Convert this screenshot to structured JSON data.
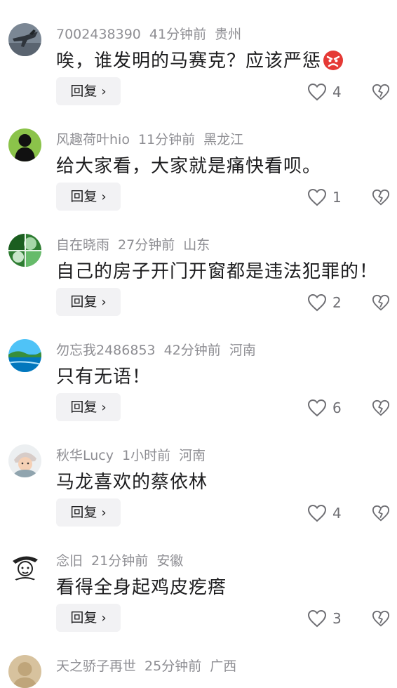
{
  "comments": [
    {
      "username": "7002438390",
      "time": "41分钟前",
      "location": "贵州",
      "text": "唉，谁发明的马赛克？应该严惩",
      "has_emoji": true,
      "reply_label": "回复",
      "likes": "4",
      "avatar": "jet"
    },
    {
      "username": "风趣荷叶hio",
      "time": "11分钟前",
      "location": "黑龙江",
      "text": "给大家看，大家就是痛快看呗。",
      "has_emoji": false,
      "reply_label": "回复",
      "likes": "1",
      "avatar": "silhouette"
    },
    {
      "username": "自在晓雨",
      "time": "27分钟前",
      "location": "山东",
      "text": "自己的房子开门开窗都是违法犯罪的！",
      "has_emoji": false,
      "reply_label": "回复",
      "likes": "2",
      "avatar": "green"
    },
    {
      "username": "勿忘我2486853",
      "time": "42分钟前",
      "location": "河南",
      "text": "只有无语！",
      "has_emoji": false,
      "reply_label": "回复",
      "likes": "6",
      "avatar": "lake"
    },
    {
      "username": "秋华Lucy",
      "time": "1小时前",
      "location": "河南",
      "text": "马龙喜欢的蔡依林",
      "has_emoji": false,
      "reply_label": "回复",
      "likes": "4",
      "avatar": "person"
    },
    {
      "username": "念旧",
      "time": "21分钟前",
      "location": "安徽",
      "text": "看得全身起鸡皮疙瘩",
      "has_emoji": false,
      "reply_label": "回复",
      "likes": "3",
      "avatar": "sketch"
    },
    {
      "username": "天之骄子再世",
      "time": "25分钟前",
      "location": "广西",
      "text": "",
      "has_emoji": false,
      "reply_label": "",
      "likes": "",
      "avatar": "beige"
    }
  ],
  "icons": {
    "reply_chevron": "chevron-right-icon",
    "like": "heart-icon",
    "dislike": "broken-heart-icon",
    "emoji": "angry-face-emoji"
  },
  "colors": {
    "meta": "#8e8e93",
    "text": "#1c1c1e",
    "reply_bg": "#f2f2f4"
  }
}
